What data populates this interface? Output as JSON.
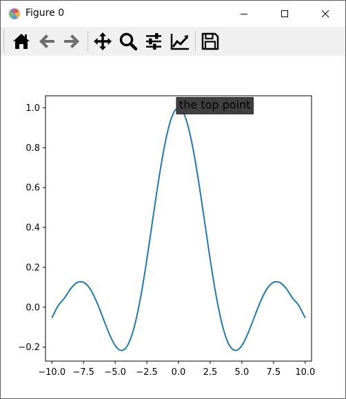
{
  "window": {
    "title": "Figure 0",
    "controls": {
      "minimize": "minimize",
      "maximize": "maximize",
      "close": "close"
    }
  },
  "toolbar": {
    "buttons": [
      {
        "name": "home",
        "icon": "home-icon"
      },
      {
        "name": "back",
        "icon": "arrow-left-icon"
      },
      {
        "name": "forward",
        "icon": "arrow-right-icon"
      },
      {
        "name": "pan",
        "icon": "move-icon"
      },
      {
        "name": "zoom",
        "icon": "magnifier-icon"
      },
      {
        "name": "subplots",
        "icon": "sliders-icon"
      },
      {
        "name": "edit",
        "icon": "line-chart-icon"
      },
      {
        "name": "save",
        "icon": "floppy-disk-icon"
      }
    ]
  },
  "chart_data": {
    "type": "line",
    "title": "",
    "xlabel": "",
    "ylabel": "",
    "xlim": [
      -10.5,
      10.5
    ],
    "ylim": [
      -0.27,
      1.06
    ],
    "xticks": [
      -10.0,
      -7.5,
      -5.0,
      -2.5,
      0.0,
      2.5,
      5.0,
      7.5,
      10.0
    ],
    "xtick_labels": [
      "−10.0",
      "−7.5",
      "−5.0",
      "−2.5",
      "0.0",
      "2.5",
      "5.0",
      "7.5",
      "10.0"
    ],
    "yticks": [
      -0.2,
      0.0,
      0.2,
      0.4,
      0.6,
      0.8,
      1.0
    ],
    "ytick_labels": [
      "−0.2",
      "0.0",
      "0.2",
      "0.4",
      "0.6",
      "0.8",
      "1.0"
    ],
    "grid": false,
    "line_color": "#1f77b4",
    "series": [
      {
        "x": [
          -10.0,
          -9.5,
          -9.0,
          -8.5,
          -8.0,
          -7.5,
          -7.0,
          -6.5,
          -6.0,
          -5.5,
          -5.0,
          -4.5,
          -4.0,
          -3.5,
          -3.0,
          -2.5,
          -2.0,
          -1.5,
          -1.0,
          -0.5,
          0.0,
          0.5,
          1.0,
          1.5,
          2.0,
          2.5,
          3.0,
          3.5,
          4.0,
          4.5,
          5.0,
          5.5,
          6.0,
          6.5,
          7.0,
          7.5,
          8.0,
          8.5,
          9.0,
          9.5,
          10.0
        ],
        "y": [
          -0.054,
          0.008,
          0.046,
          0.094,
          0.124,
          0.125,
          0.094,
          0.033,
          -0.047,
          -0.128,
          -0.192,
          -0.217,
          -0.189,
          -0.1,
          0.047,
          0.239,
          0.455,
          0.665,
          0.841,
          0.959,
          1.0,
          0.959,
          0.841,
          0.665,
          0.455,
          0.239,
          0.047,
          -0.1,
          -0.189,
          -0.217,
          -0.192,
          -0.128,
          -0.047,
          0.033,
          0.094,
          0.125,
          0.124,
          0.094,
          0.046,
          0.008,
          -0.054
        ]
      }
    ],
    "annotation": {
      "text": "the top point",
      "x": 0.0,
      "y": 1.0,
      "text_color": "#6cb5e8",
      "box_color": "#404040"
    }
  }
}
